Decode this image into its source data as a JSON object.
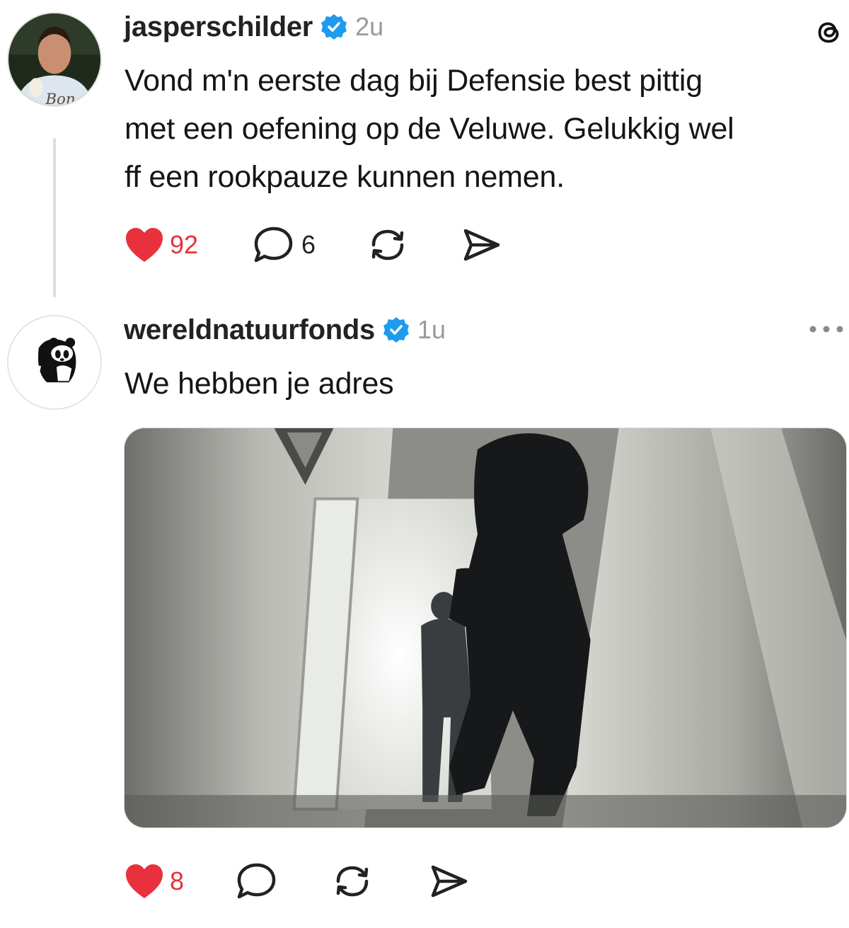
{
  "post1": {
    "username": "jasperschilder",
    "time": "2u",
    "text_lines": [
      "Vond m'n eerste dag bij Defensie best pittig",
      "met een oefening op de Veluwe. Gelukkig wel",
      "ff een rookpauze kunnen nemen."
    ],
    "likes": "92",
    "replies": "6",
    "avatar_caption": "Bon"
  },
  "post2": {
    "username": "wereldnatuurfonds",
    "time": "1u",
    "text": "We hebben je adres",
    "likes": "8"
  },
  "colors": {
    "like_red": "#e8313d",
    "verified_blue": "#1d9bf0",
    "muted_gray": "#9a9a9a"
  },
  "icons": [
    "threads-logo-icon",
    "verified-icon",
    "heart-icon",
    "comment-icon",
    "repost-icon",
    "share-icon",
    "more-icon"
  ]
}
